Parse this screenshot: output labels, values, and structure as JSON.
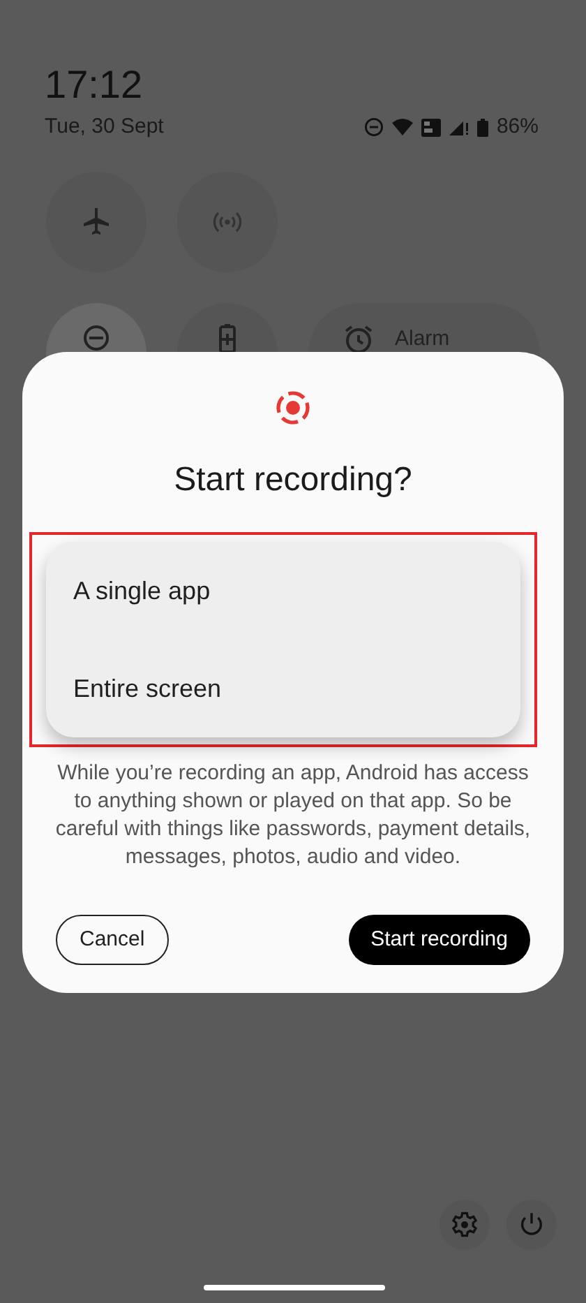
{
  "status_bar": {
    "time": "17:12",
    "date": "Tue, 30 Sept",
    "battery": "86%"
  },
  "tiles": [
    {
      "kind": "airplane",
      "on": false
    },
    {
      "kind": "hotspot",
      "on": false
    },
    {
      "kind": "dnd",
      "on": true
    },
    {
      "kind": "battery-saver",
      "on": false
    },
    {
      "kind": "alarm",
      "on": false,
      "label": "Alarm"
    }
  ],
  "dialog": {
    "title": "Start recording?",
    "options": [
      {
        "label": "A single app"
      },
      {
        "label": "Entire screen"
      }
    ],
    "message": "While you’re recording an app, Android has access to anything shown or played on that app. So be careful with things like passwords, payment details, messages, photos, audio and video.",
    "buttons": [
      {
        "kind": "outline",
        "label": "Cancel"
      },
      {
        "kind": "filled",
        "label": "Start recording"
      }
    ]
  }
}
